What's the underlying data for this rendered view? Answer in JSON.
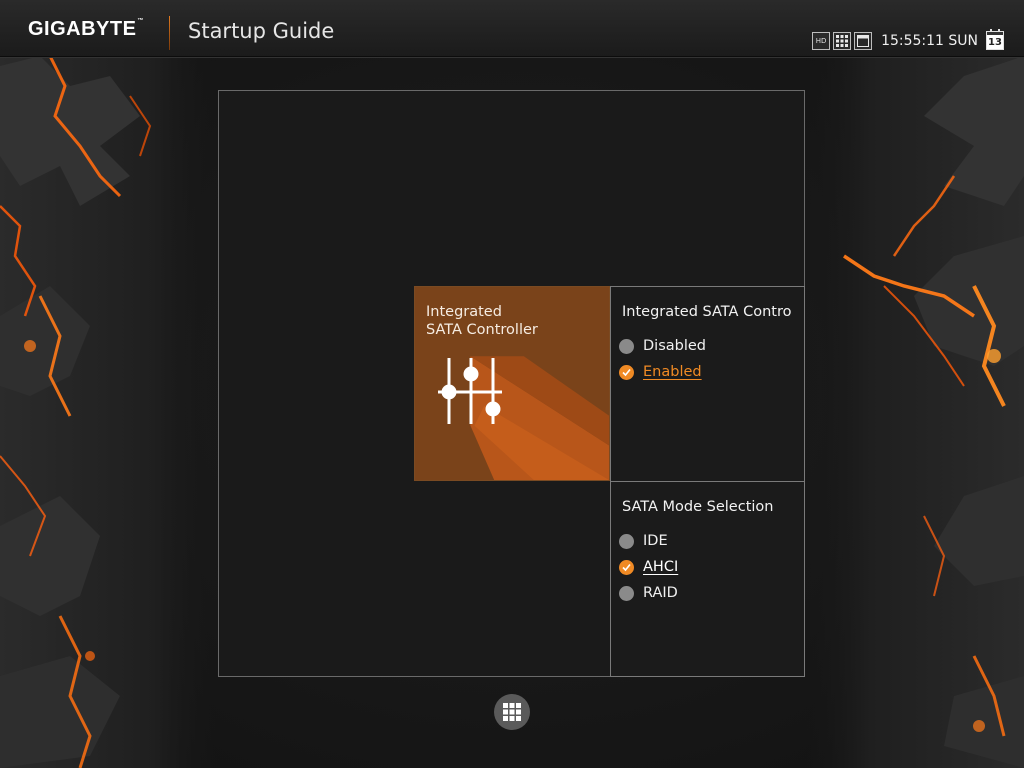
{
  "header": {
    "brand": "GIGABYTE",
    "brand_tm": "™",
    "title": "Startup Guide",
    "time": "15:55:11 SUN",
    "calendar_day": "13",
    "hd_label": "HD"
  },
  "tile": {
    "line1": "Integrated",
    "line2": "SATA Controller",
    "icon": "sliders-icon"
  },
  "sata_panel": {
    "title": "Integrated SATA Contro",
    "options": [
      {
        "label": "Disabled",
        "selected": false
      },
      {
        "label": "Enabled",
        "selected": true
      }
    ]
  },
  "mode_panel": {
    "title": "SATA Mode Selection",
    "options": [
      {
        "label": "IDE",
        "selected": false
      },
      {
        "label": "AHCI",
        "selected": true
      },
      {
        "label": "RAID",
        "selected": false
      }
    ]
  },
  "colors": {
    "accent": "#f08a24",
    "tile_bg": "#7a431a",
    "radio_off": "#8a8a8a"
  },
  "icons": {
    "hd": "hd-icon",
    "grid": "grid-icon",
    "window": "window-icon",
    "calendar": "calendar-icon",
    "menu": "apps-grid-icon"
  }
}
